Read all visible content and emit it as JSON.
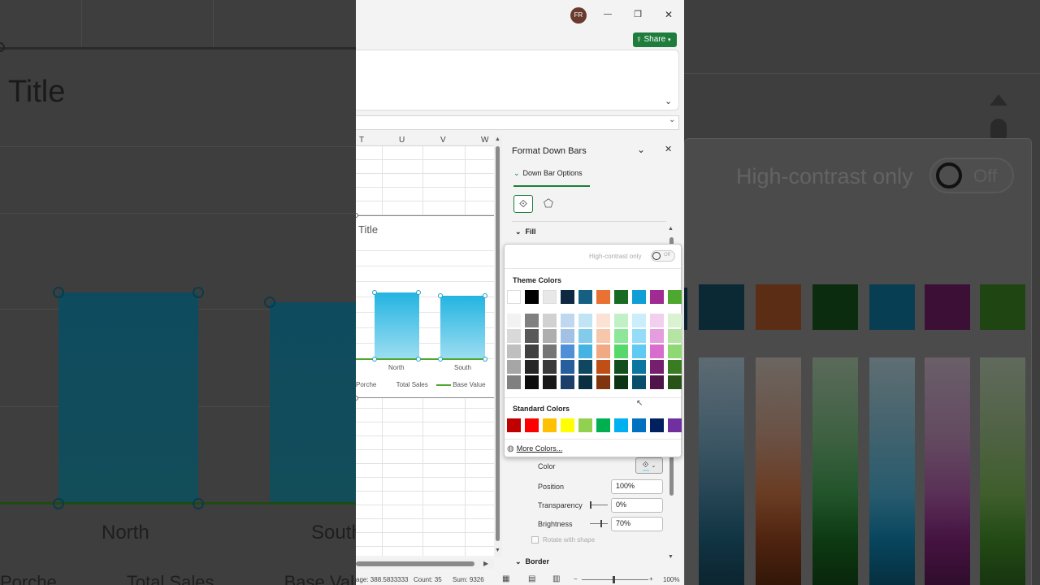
{
  "window": {
    "user_initials": "FR",
    "share_label": "Share",
    "minimize_glyph": "—",
    "restore_glyph": "❐",
    "close_glyph": "✕"
  },
  "sheet": {
    "columns": [
      "T",
      "U",
      "V",
      "W"
    ],
    "chart_title_partial": "Title",
    "categories": [
      "North",
      "South"
    ],
    "legend_items": [
      "Porche",
      "Total Sales",
      "Base Value"
    ]
  },
  "status": {
    "average": "age: 388.5833333",
    "count": "Count: 35",
    "sum": "Sum: 9326",
    "zoom": "100%"
  },
  "pane": {
    "title": "Format Down Bars",
    "tab_label": "Down Bar Options",
    "fill_section": "Fill",
    "border_section": "Border",
    "color_label": "Color",
    "position_label": "Position",
    "position_value": "100%",
    "transparency_label": "Transparency",
    "transparency_value": "0%",
    "brightness_label": "Brightness",
    "brightness_value": "70%",
    "rotate_label": "Rotate with shape"
  },
  "color_picker": {
    "high_contrast_label": "High-contrast only",
    "toggle_text": "Off",
    "theme_colors_label": "Theme Colors",
    "standard_colors_label": "Standard Colors",
    "more_colors_label": "More Colors...",
    "theme_colors": [
      "#ffffff",
      "#000000",
      "#e8e8e8",
      "#0e2841",
      "#156082",
      "#e97132",
      "#196b24",
      "#0f9ed5",
      "#a02b93",
      "#4ea72e"
    ],
    "theme_tints": [
      [
        "#f2f2f2",
        "#808080",
        "#d1d1d1",
        "#c0d8ef",
        "#c1e4f5",
        "#fbe2d5",
        "#c1f0c7",
        "#caeefb",
        "#f2cfee",
        "#d9f2d0"
      ],
      [
        "#d9d9d9",
        "#595959",
        "#aeaeae",
        "#a1c1e5",
        "#83cbeb",
        "#f7c7ac",
        "#8ee69b",
        "#95dcf8",
        "#e49edd",
        "#b4e5a2"
      ],
      [
        "#bfbfbf",
        "#404040",
        "#757575",
        "#4f8fd8",
        "#44b3e1",
        "#f1a983",
        "#57d86a",
        "#60caf3",
        "#d86dcd",
        "#8ed973"
      ],
      [
        "#a6a6a6",
        "#262626",
        "#3a3a3a",
        "#275e9e",
        "#0f4761",
        "#c04f15",
        "#134f1c",
        "#0b769f",
        "#76206d",
        "#3a7c22"
      ],
      [
        "#808080",
        "#0d0d0d",
        "#171717",
        "#1b3f6a",
        "#0a2f40",
        "#80350e",
        "#0d3412",
        "#074f6a",
        "#501449",
        "#275317"
      ]
    ],
    "standard_colors": [
      "#c00000",
      "#ff0000",
      "#ffc000",
      "#ffff00",
      "#92d050",
      "#00b050",
      "#00b0f0",
      "#0070c0",
      "#002060",
      "#7030a0"
    ]
  }
}
